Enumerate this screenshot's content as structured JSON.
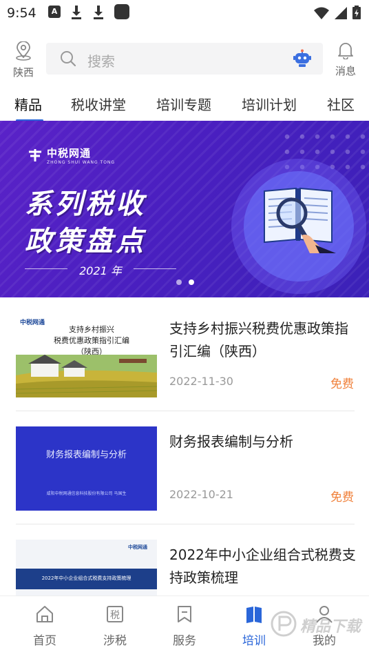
{
  "status": {
    "time": "9:54",
    "notif_glyph": "A"
  },
  "header": {
    "location": "陕西",
    "search_placeholder": "搜索",
    "messages": "消息"
  },
  "tabs": [
    "精品",
    "税收讲堂",
    "培训专题",
    "培训计划",
    "社区"
  ],
  "banner": {
    "logo_text": "中税网通",
    "logo_sub": "ZHONG SHUI WANG TONG",
    "line1": "系列税收",
    "line2": "政策盘点",
    "year": "2021 年",
    "slide_count": 2,
    "active_slide": 2
  },
  "items": [
    {
      "thumb_title": "支持乡村振兴\n税费优惠政策指引汇编\n（陕西）",
      "thumb_logo": "中税网通",
      "title": "支持乡村振兴税费优惠政策指引汇编（陕西）",
      "date": "2022-11-30",
      "price": "免费"
    },
    {
      "thumb_title": "财务报表编制与分析",
      "thumb_sub": "咸阳中税网通信息科技股份有限公司  马国生",
      "title": "财务报表编制与分析",
      "date": "2022-10-21",
      "price": "免费"
    },
    {
      "thumb_title": "2022年中小企业组合式税费支持政策梳理",
      "thumb_logo": "中税网通",
      "title": "2022年中小企业组合式税费支持政策梳理"
    }
  ],
  "nav": [
    {
      "label": "首页",
      "icon": "home-icon"
    },
    {
      "label": "涉税",
      "icon": "tax-icon",
      "glyph": "税"
    },
    {
      "label": "服务",
      "icon": "service-icon"
    },
    {
      "label": "培训",
      "icon": "book-icon",
      "active": true
    },
    {
      "label": "我的",
      "icon": "user-icon"
    }
  ],
  "watermark": "精品下载",
  "colors": {
    "accent": "#2a66d9",
    "price": "#f0803a",
    "banner": "#4a1fc0"
  }
}
